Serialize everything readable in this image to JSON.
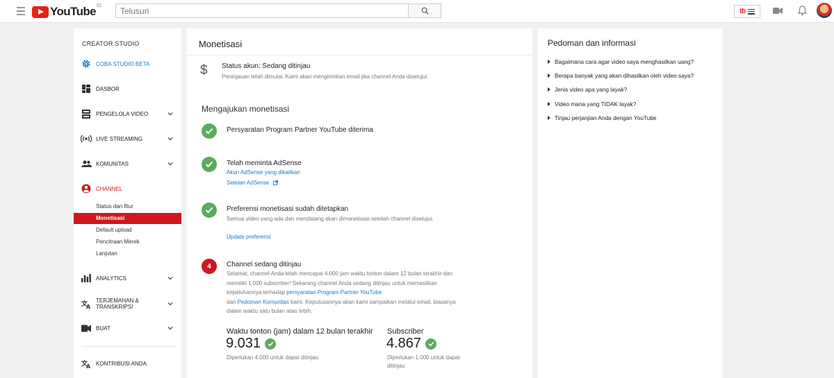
{
  "topbar": {
    "logo_text": "YouTube",
    "region": "ID",
    "search_placeholder": "Telusuri",
    "extension_label": "tb"
  },
  "sidebar": {
    "title": "CREATOR STUDIO",
    "items": [
      {
        "label": "COBA STUDIO BETA",
        "icon": "gear-icon"
      },
      {
        "label": "DASBOR",
        "icon": "dashboard-icon"
      },
      {
        "label": "PENGELOLA VIDEO",
        "icon": "video-manager-icon"
      },
      {
        "label": "LIVE STREAMING",
        "icon": "live-icon"
      },
      {
        "label": "KOMUNITAS",
        "icon": "community-icon"
      },
      {
        "label": "CHANNEL",
        "icon": "channel-icon"
      },
      {
        "label": "ANALYTICS",
        "icon": "analytics-icon"
      },
      {
        "label": "TERJEMAHAN &",
        "label2": "TRANSKRIPSI",
        "icon": "translate-icon"
      },
      {
        "label": "BUAT",
        "icon": "create-icon"
      },
      {
        "label": "KONTRIBUSI ANDA",
        "icon": "contribute-icon"
      }
    ],
    "channel_subitems": [
      "Status dan fitur",
      "Monetisasi",
      "Default upload",
      "Pencitraan Merek",
      "Lanjutan"
    ]
  },
  "main": {
    "title": "Monetisasi",
    "status_title": "Status akun: Sedang ditinjau",
    "status_desc": "Peninjauan telah dimulai. Kami akan mengirimkan email jika channel Anda disetujui.",
    "section_title": "Mengajukan monetisasi",
    "steps": [
      {
        "title": "Persyaratan Program Partner YouTube diterima"
      },
      {
        "title": "Telah meminta AdSense",
        "links": [
          "Akun AdSense yang dikaitkan",
          "Setelan AdSense"
        ]
      },
      {
        "title": "Preferensi monetisasi sudah ditetapkan",
        "desc": "Semua video yang ada dan mendatang akan dimonetisasi setelah channel disetujui.",
        "link": "Update preferensi"
      },
      {
        "number": "4",
        "title": "Channel sedang ditinjau",
        "desc_a": "Selamat, channel Anda telah mencapai 4.000 jam waktu tonton dalam 12 bulan terakhir dan memiliki 1.000 subscriber! Sekarang channel Anda sedang ditinjau untuk memastikan kepatuhannya terhadap ",
        "desc_link1": "persyaratan Program Partner YouTube",
        "desc_b": "dan ",
        "desc_link2": "Pedoman Komunitas",
        "desc_c": " kami. Keputusannya akan kami sampaikan melalui email, biasanya dalam waktu satu bulan atau lebih."
      }
    ],
    "stats": [
      {
        "label": "Waktu tonton (jam) dalam 12 bulan terakhir",
        "value": "9.031",
        "note": "Diperlukan 4.000 untuk dapat ditinjau"
      },
      {
        "label": "Subscriber",
        "value": "4.867",
        "note": "Diperlukan 1.000 untuk dapat ditinjau"
      }
    ]
  },
  "right": {
    "title": "Pedoman dan informasi",
    "items": [
      "Bagaimana cara agar video saya menghasilkan uang?",
      "Berapa banyak yang akan dihasilkan oleh video saya?",
      "Jenis video apa yang layak?",
      "Video mana yang TIDAK layak?",
      "Tinjau perjanjian Anda dengan YouTube"
    ]
  },
  "colors": {
    "accent_red": "#cc181e",
    "link_blue": "#167ac6",
    "success_green": "#5aac5f"
  }
}
